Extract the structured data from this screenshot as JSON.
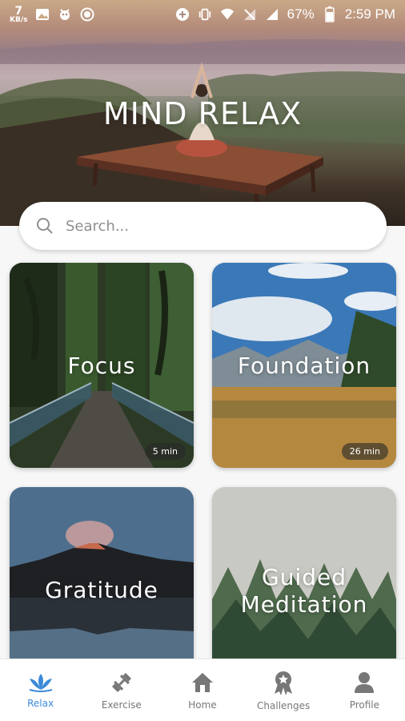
{
  "status_bar": {
    "speed_value": "7",
    "speed_unit": "KB/s",
    "battery": "67%",
    "time": "2:59 PM"
  },
  "hero": {
    "title": "MIND RELAX"
  },
  "search": {
    "placeholder": "Search..."
  },
  "cards": [
    {
      "title": "Focus",
      "duration": "5 min"
    },
    {
      "title": "Foundation",
      "duration": "26 min"
    },
    {
      "title": "Gratitude"
    },
    {
      "title_line1": "Guided",
      "title_line2": "Meditation"
    }
  ],
  "nav": {
    "items": [
      {
        "label": "Relax",
        "icon": "lotus-icon"
      },
      {
        "label": "Exercise",
        "icon": "dumbbell-icon"
      },
      {
        "label": "Home",
        "icon": "home-icon"
      },
      {
        "label": "Challenges",
        "icon": "award-icon"
      },
      {
        "label": "Profile",
        "icon": "person-icon"
      }
    ],
    "active": "Relax",
    "active_color": "#3b8ad9",
    "inactive_color": "#777777"
  }
}
